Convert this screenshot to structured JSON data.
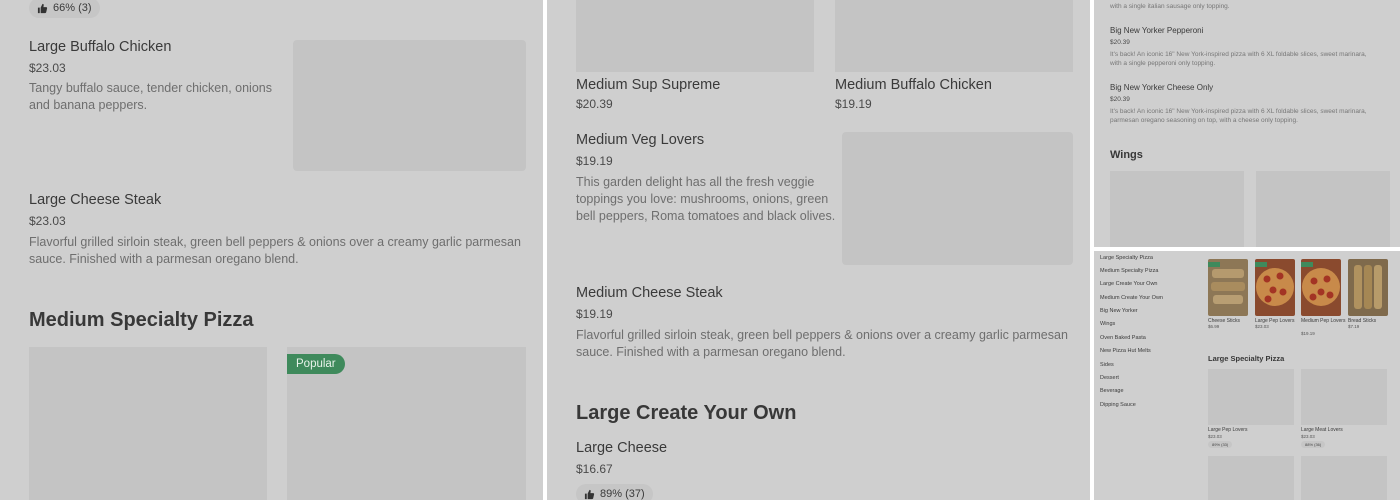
{
  "panel1": {
    "rating": "66% (3)",
    "items": [
      {
        "name": "Large Buffalo Chicken",
        "price": "$23.03",
        "desc_lines": [
          "Tangy buffalo sauce, tender chicken, onions",
          "and banana peppers."
        ]
      },
      {
        "name": "Large Cheese Steak",
        "price": "$23.03",
        "desc_lines": [
          "Flavorful grilled sirloin steak, green bell peppers & onions over a creamy garlic parmesan",
          "sauce. Finished with a parmesan oregano blend."
        ]
      }
    ],
    "section_title": "Medium Specialty Pizza",
    "popular_badge": "Popular"
  },
  "panel2": {
    "top_items": [
      {
        "name": "Medium Sup Supreme",
        "price": "$20.39"
      },
      {
        "name": "Medium Buffalo Chicken",
        "price": "$19.19"
      }
    ],
    "veg": {
      "name": "Medium Veg Lovers",
      "price": "$19.19",
      "desc_lines": [
        "This garden delight has all the fresh veggie",
        "toppings you love: mushrooms, onions, green",
        "bell peppers, Roma tomatoes and black olives."
      ]
    },
    "steak": {
      "name": "Medium Cheese Steak",
      "price": "$19.19",
      "desc_lines": [
        "Flavorful grilled sirloin steak, green bell peppers & onions over a creamy garlic parmesan",
        "sauce. Finished with a parmesan oregano blend."
      ]
    },
    "section_title": "Large Create Your Own",
    "cheese": {
      "name": "Large Cheese",
      "price": "$16.67",
      "rating": "89% (37)"
    }
  },
  "panel3": {
    "top_desc": "with a single italian sausage only topping.",
    "items": [
      {
        "name": "Big New Yorker Pepperoni",
        "price": "$20.39",
        "desc_lines": [
          "It's back! An iconic 16\" New York-inspired pizza with 6 XL foldable slices, sweet marinara,",
          "with a single pepperoni only topping."
        ]
      },
      {
        "name": "Big New Yorker Cheese Only",
        "price": "$20.39",
        "desc_lines": [
          "It's back! An iconic 16\" New York-inspired pizza with 6 XL foldable slices, sweet marinara,",
          "parmesan oregano seasoning on top, with a cheese only topping."
        ]
      }
    ],
    "section_title": "Wings"
  },
  "panel4": {
    "nav": [
      "Large Specialty Pizza",
      "Medium Specialty Pizza",
      "Large Create Your Own",
      "Medium Create Your Own",
      "Big New Yorker",
      "Wings",
      "Oven Baked Pasta",
      "New Pizza Hut Melts",
      "Sides",
      "Dessert",
      "Beverage",
      "Dipping Sauce"
    ],
    "cards": [
      {
        "name": "Cheese Sticks",
        "price": "$6.99",
        "icon": "breadsticks"
      },
      {
        "name": "Large Pep Lovers",
        "price": "$23.03",
        "icon": "pepperoni-pizza"
      },
      {
        "name": "Medium Pep Lovers",
        "price": "$19.19",
        "icon": "pepperoni-pizza"
      },
      {
        "name": "Bread Sticks",
        "price": "$7.19",
        "icon": "breadsticks"
      }
    ],
    "section_title": "Large Specialty Pizza",
    "grid": [
      {
        "name": "Large Pep Lovers",
        "price": "$23.03",
        "rating": "89% (33)"
      },
      {
        "name": "Large Meat Lovers",
        "price": "$23.03",
        "rating": "88% (36)"
      }
    ]
  },
  "colors": {
    "overlay": "#cfcfcf",
    "placeholder": "#c4c4c4",
    "badge_green": "#3f8a5c"
  }
}
